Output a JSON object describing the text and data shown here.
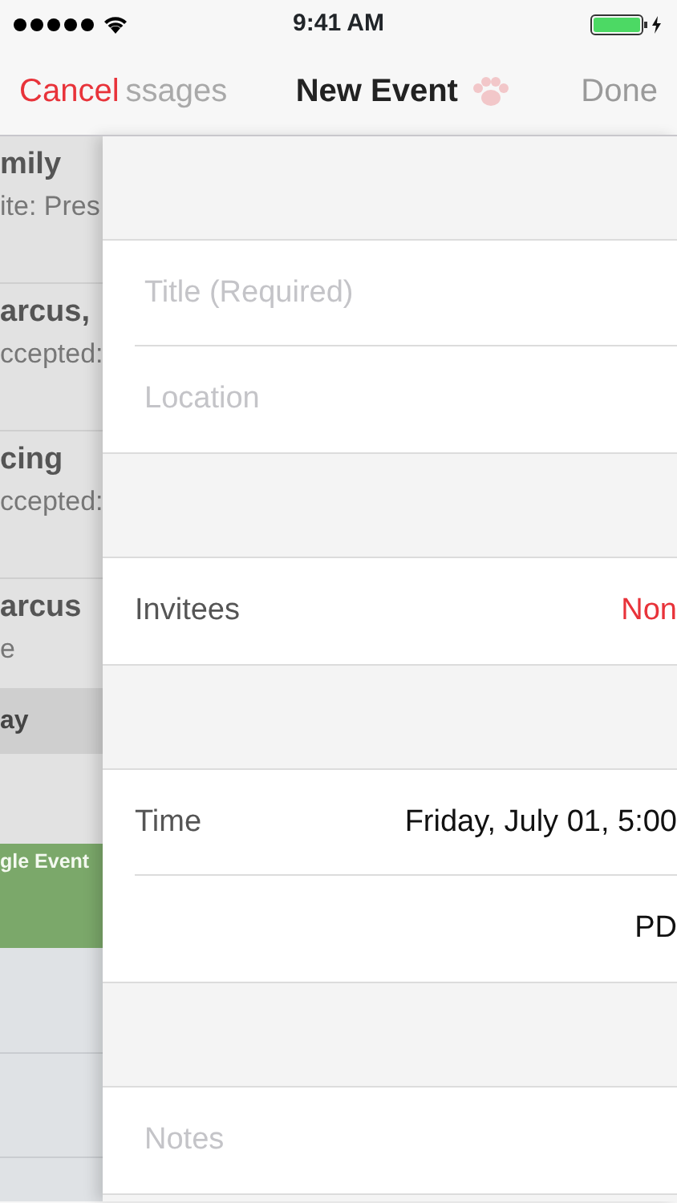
{
  "status_bar": {
    "time": "9:41 AM"
  },
  "nav_bar": {
    "cancel": "Cancel",
    "behind_back": "ssages",
    "title": "New Event",
    "done": {
      "label": "Done",
      "disabled": true
    }
  },
  "background_list": {
    "items": [
      {
        "title": "mily",
        "subtitle": "ite: Pres"
      },
      {
        "title": "arcus,",
        "subtitle": "ccepted:"
      },
      {
        "title": "cing",
        "subtitle": "ccepted:"
      },
      {
        "title": "arcus",
        "subtitle": "e"
      }
    ],
    "day_header": "ay",
    "event": {
      "title": "gle Event",
      "color": "#7ba86a"
    }
  },
  "form": {
    "sections": [
      {
        "rows": [
          {
            "kind": "field",
            "placeholder": "Title (Required)"
          },
          {
            "kind": "field",
            "placeholder": "Location"
          }
        ]
      },
      {
        "rows": [
          {
            "kind": "value",
            "label": "Invitees",
            "value": "Non",
            "accent": true
          }
        ]
      },
      {
        "rows": [
          {
            "kind": "value",
            "label": "Time",
            "value": "Friday, July 01, 5:00",
            "accent": false
          },
          {
            "kind": "value",
            "value": "PD",
            "accent": false
          }
        ]
      },
      {
        "rows": [
          {
            "kind": "field",
            "placeholder": "Notes"
          }
        ]
      }
    ]
  }
}
